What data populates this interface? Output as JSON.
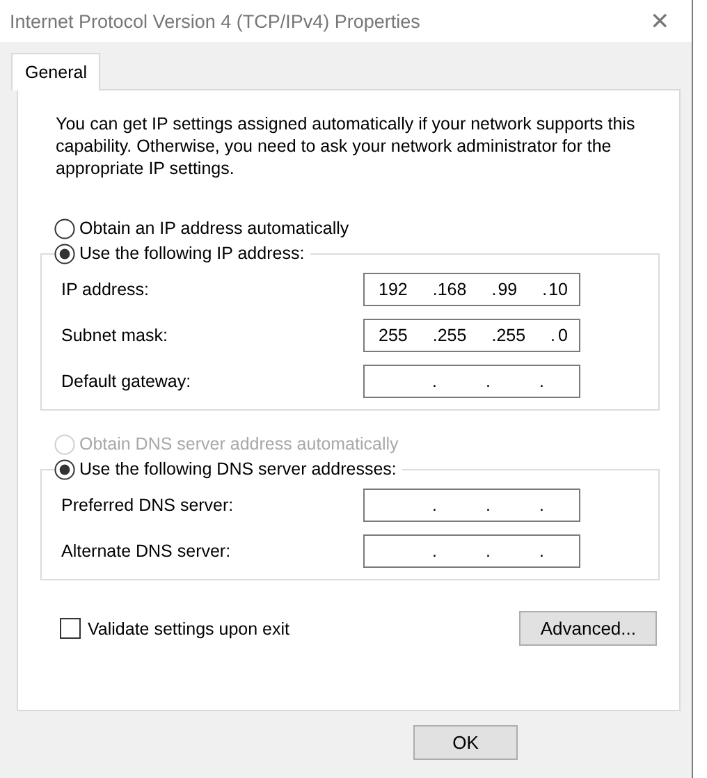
{
  "window": {
    "title": "Internet Protocol Version 4 (TCP/IPv4) Properties",
    "close": "✕"
  },
  "tabs": [
    {
      "label": "General",
      "selected": true
    }
  ],
  "description": "You can get IP settings assigned automatically if your network supports this capability. Otherwise, you need to ask your network administrator for the appropriate IP settings.",
  "octet_separator": ".",
  "ip_section": {
    "auto_option": {
      "label": "Obtain an IP address automatically",
      "selected": false,
      "disabled": false
    },
    "manual_option": {
      "label": "Use the following IP address:",
      "selected": true,
      "disabled": false
    },
    "fields": [
      {
        "label": "IP address:",
        "octets": [
          "192",
          "168",
          "99",
          "10"
        ]
      },
      {
        "label": "Subnet mask:",
        "octets": [
          "255",
          "255",
          "255",
          "0"
        ]
      },
      {
        "label": "Default gateway:"
      }
    ]
  },
  "dns_section": {
    "auto_option": {
      "label": "Obtain DNS server address automatically",
      "selected": false,
      "disabled": true
    },
    "manual_option": {
      "label": "Use the following DNS server addresses:",
      "selected": true,
      "disabled": false
    },
    "fields": [
      {
        "label": "Preferred DNS server:"
      },
      {
        "label": "Alternate DNS server:"
      }
    ]
  },
  "validate": {
    "label": "Validate settings upon exit",
    "checked": false
  },
  "advanced_button": "Advanced...",
  "buttons": [
    "OK"
  ]
}
